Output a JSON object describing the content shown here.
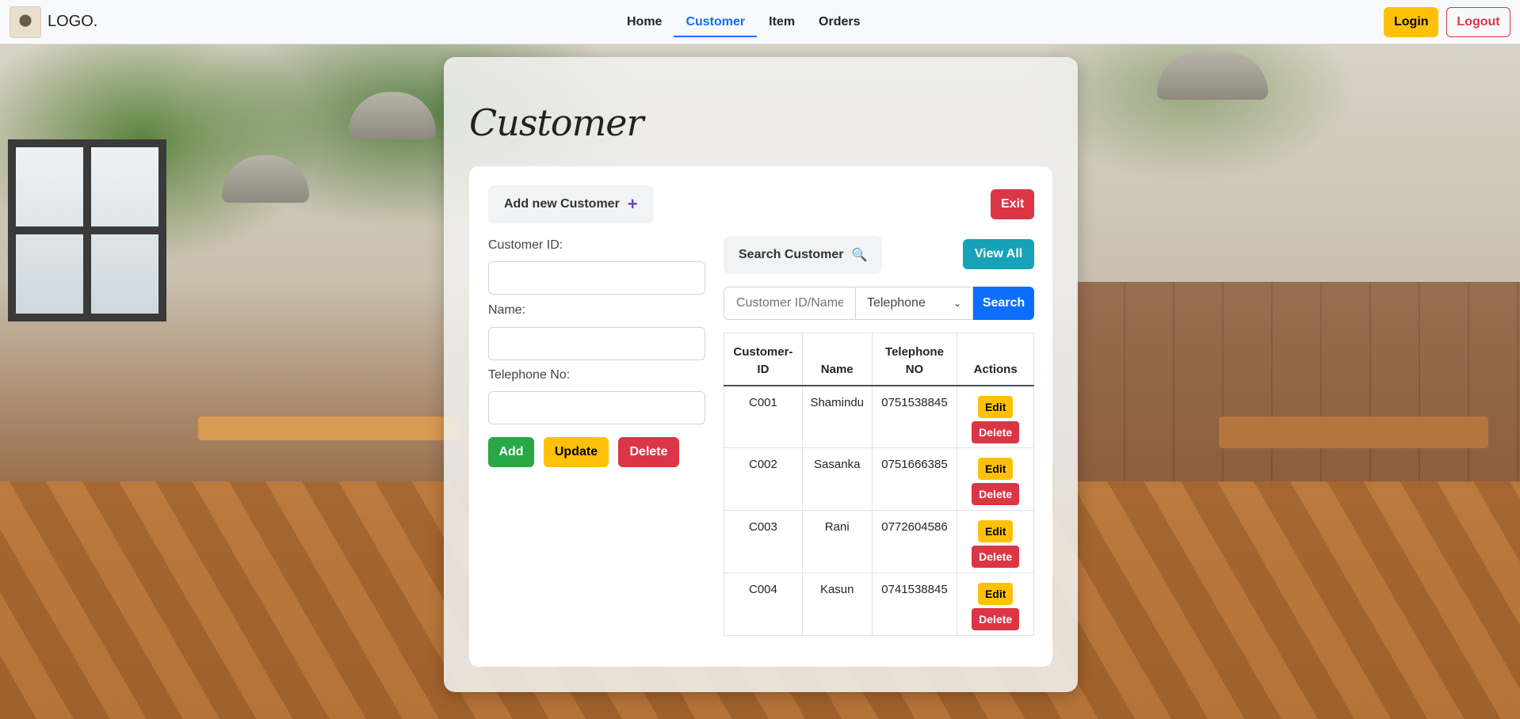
{
  "navbar": {
    "brand_text": "LOGO.",
    "links": [
      {
        "label": "Home",
        "active": false
      },
      {
        "label": "Customer",
        "active": true
      },
      {
        "label": "Item",
        "active": false
      },
      {
        "label": "Orders",
        "active": false
      }
    ],
    "login_label": "Login",
    "logout_label": "Logout"
  },
  "page": {
    "title": "Customer"
  },
  "form": {
    "add_new_label": "Add new Customer",
    "exit_label": "Exit",
    "customer_id_label": "Customer ID:",
    "customer_id_value": "",
    "name_label": "Name:",
    "name_value": "",
    "telephone_label": "Telephone No:",
    "telephone_value": "",
    "add_label": "Add",
    "update_label": "Update",
    "delete_label": "Delete"
  },
  "search": {
    "title": "Search Customer",
    "view_all_label": "View All",
    "input_placeholder": "Customer ID/Name",
    "input_value": "",
    "filter_selected": "Telephone",
    "search_button_label": "Search"
  },
  "table": {
    "headers": [
      "Customer-ID",
      "Name",
      "Telephone NO",
      "Actions"
    ],
    "edit_label": "Edit",
    "delete_label": "Delete",
    "rows": [
      {
        "id": "C001",
        "name": "Shamindu",
        "telephone": "0751538845"
      },
      {
        "id": "C002",
        "name": "Sasanka",
        "telephone": "0751666385"
      },
      {
        "id": "C003",
        "name": "Rani",
        "telephone": "0772604586"
      },
      {
        "id": "C004",
        "name": "Kasun",
        "telephone": "0741538845"
      }
    ]
  },
  "colors": {
    "primary": "#0d6efd",
    "warning": "#ffc107",
    "danger": "#dc3545",
    "success": "#28a745",
    "info": "#17a2b8"
  },
  "icons": {
    "add_new": "plus-icon",
    "search": "magnifier-icon",
    "select": "chevron-down-icon",
    "brand": "logo-image"
  }
}
